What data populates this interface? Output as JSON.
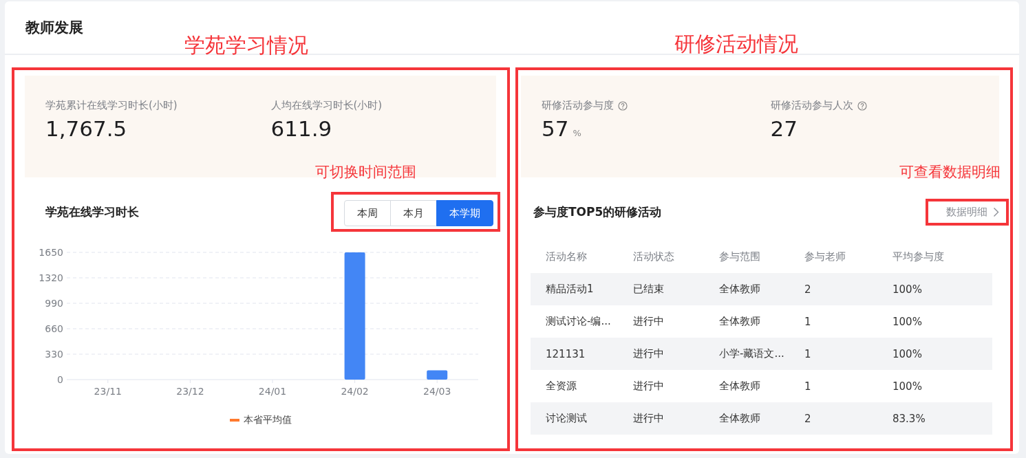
{
  "title": "教师发展",
  "annotations": {
    "left_title": "学苑学习情况",
    "right_title": "研修活动情况",
    "range_hint": "可切换时间范围",
    "detail_hint": "可查看数据明细"
  },
  "learning": {
    "stats": [
      {
        "label": "学苑累计在线学习时长(小时)",
        "value": "1,767.5"
      },
      {
        "label": "人均在线学习时长(小时)",
        "value": "611.9"
      }
    ],
    "chart_title": "学苑在线学习时长",
    "ranges": [
      {
        "label": "本周",
        "selected": false
      },
      {
        "label": "本月",
        "selected": false
      },
      {
        "label": "本学期",
        "selected": true
      }
    ],
    "chart_data": {
      "type": "bar",
      "grid": true,
      "categories": [
        "23/11",
        "23/12",
        "24/01",
        "24/02",
        "24/03"
      ],
      "ylim": [
        0,
        1650
      ],
      "yticks": [
        0,
        330,
        660,
        990,
        1320,
        1650
      ],
      "series": [
        {
          "color": "#4386f5",
          "values": [
            0,
            0,
            0,
            1650,
            120
          ]
        }
      ]
    },
    "legend": [
      {
        "label": "本省平均值",
        "color": "#ff7a2e"
      }
    ]
  },
  "activities": {
    "stats": [
      {
        "label": "研修活动参与度",
        "help": true,
        "value": "57",
        "unit": "%"
      },
      {
        "label": "研修活动参与人次",
        "help": true,
        "value": "27"
      }
    ],
    "table_title": "参与度TOP5的研修活动",
    "detail_link": "数据明细",
    "columns": [
      "活动名称",
      "活动状态",
      "参与范围",
      "参与老师",
      "平均参与度"
    ],
    "rows": [
      [
        "精品活动1",
        "已结束",
        "全体教师",
        "2",
        "100%"
      ],
      [
        "测试讨论-编...",
        "进行中",
        "全体教师",
        "1",
        "100%"
      ],
      [
        "121131",
        "进行中",
        "小学-藏语文...",
        "1",
        "100%"
      ],
      [
        "全资源",
        "进行中",
        "全体教师",
        "1",
        "100%"
      ],
      [
        "讨论测试",
        "进行中",
        "全体教师",
        "2",
        "83.3%"
      ]
    ]
  }
}
